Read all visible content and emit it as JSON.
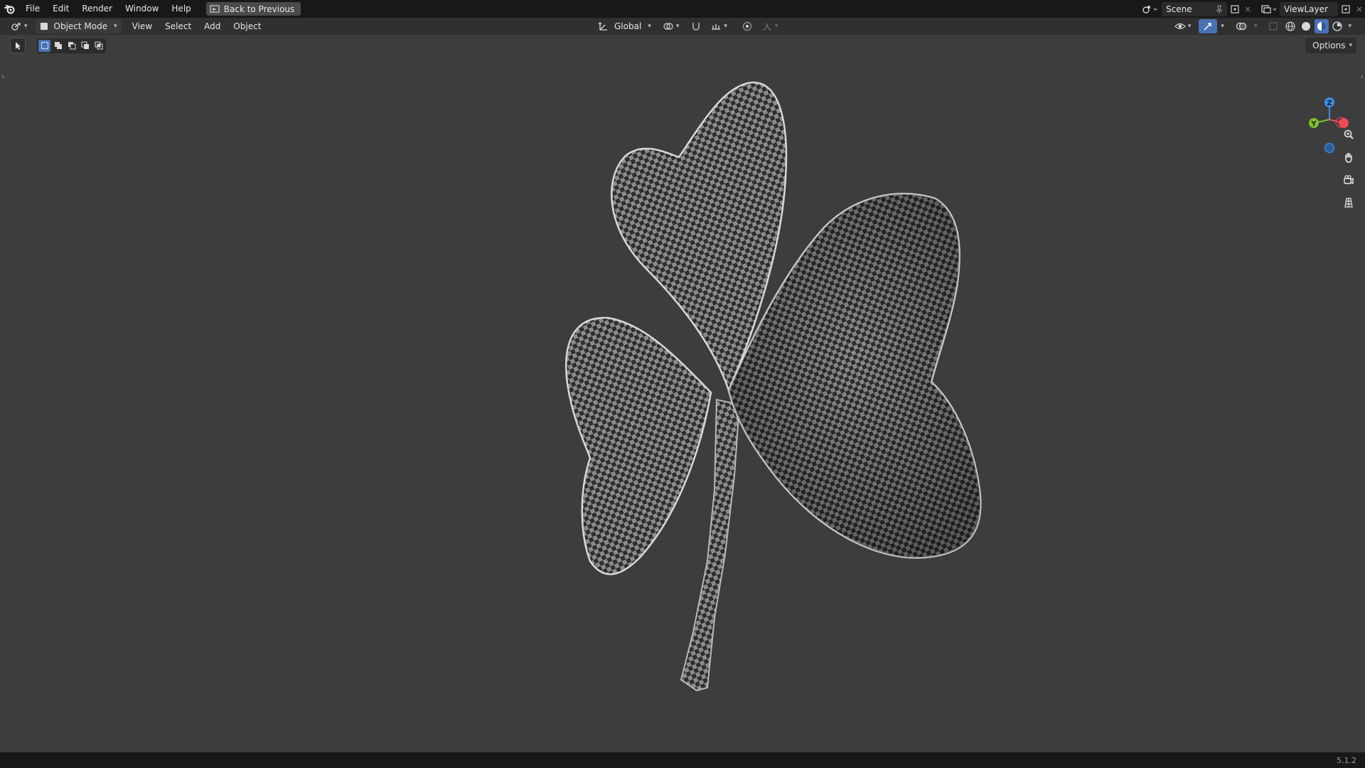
{
  "menubar": {
    "items": [
      "File",
      "Edit",
      "Render",
      "Window",
      "Help"
    ],
    "back_button": "Back to Previous",
    "scene": "Scene",
    "view_layer": "ViewLayer"
  },
  "header": {
    "mode": "Object Mode",
    "menus": [
      "View",
      "Select",
      "Add",
      "Object"
    ],
    "transform_orientation": "Global",
    "options": "Options"
  },
  "icons": {
    "logo": "blender-logo-icon",
    "zoom": "zoom-icon",
    "pan": "hand-icon",
    "camera": "camera-icon",
    "perspective": "grid-icon"
  },
  "gizmo": {
    "z": "Z",
    "y": "Y"
  },
  "colors": {
    "axis_x": "#ed4a55",
    "axis_y": "#7fbf2f",
    "axis_z": "#3d8de9",
    "active_blue": "#4772b3"
  },
  "status": {
    "version": "5.1.2"
  }
}
